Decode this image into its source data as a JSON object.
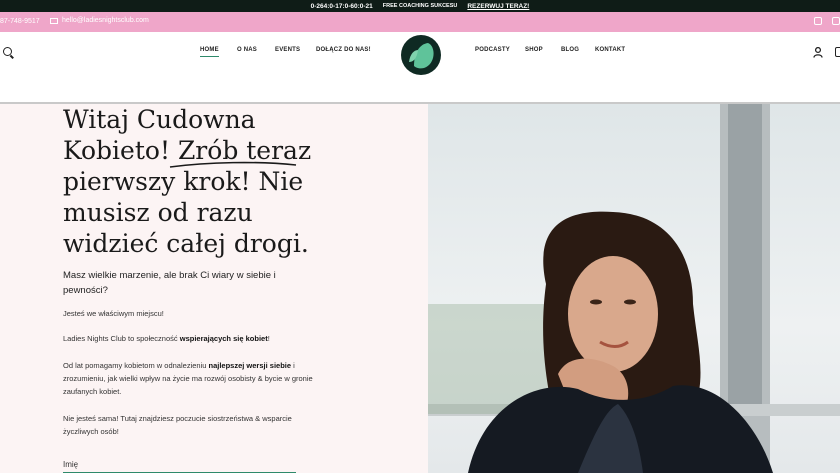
{
  "top_bar": {
    "hours": "0-264:0-17:0-60:0-21",
    "promo": "FREE COACHING SUKCESU",
    "cta": "REZERWUJ TERAZ!"
  },
  "contact_bar": {
    "phone": "87-748-9517",
    "email": "hello@ladiesnightsclub.com"
  },
  "nav": {
    "left_items": [
      "HOME",
      "O NAS",
      "EVENTS",
      "DOŁĄCZ DO NAS!"
    ],
    "right_items": [
      "PODCASTY",
      "SHOP",
      "BLOG",
      "KONTAKT"
    ],
    "active": "HOME",
    "logo_colors": [
      "#0f2a23",
      "#5fc39a"
    ]
  },
  "hero": {
    "heading_lines": [
      "Witaj Cudowna",
      "Kobieto! Zrób teraz",
      "pierwszy krok! Nie",
      "musisz od razu",
      "widzieć całej drogi."
    ],
    "lead": "Masz wielkie marzenie, ale brak Ci wiary w siebie i pewności?",
    "p1": "Jesteś we właściwym miejscu!",
    "p2_pre": "Ladies Nights Club to społeczność ",
    "p2_bold": "wspierających się kobiet",
    "p2_post": "!",
    "p3_pre": "Od lat pomagamy kobietom w odnalezieniu ",
    "p3_bold": "najlepszej wersji siebie",
    "p3_post": " i zrozumieniu, jak wielki wpływ na życie ma rozwój osobisty & bycie w gronie zaufanych kobiet.",
    "p4": "Nie jesteś sama! Tutaj znajdziesz poczucie siostrzeństwa & wsparcie życzliwych osób!",
    "form_label": "Imię"
  },
  "colors": {
    "top_bar": "#0f1c17",
    "pink": "#efa6c9",
    "accent": "#2e8a6a",
    "hero_bg": "#fcf4f4"
  }
}
